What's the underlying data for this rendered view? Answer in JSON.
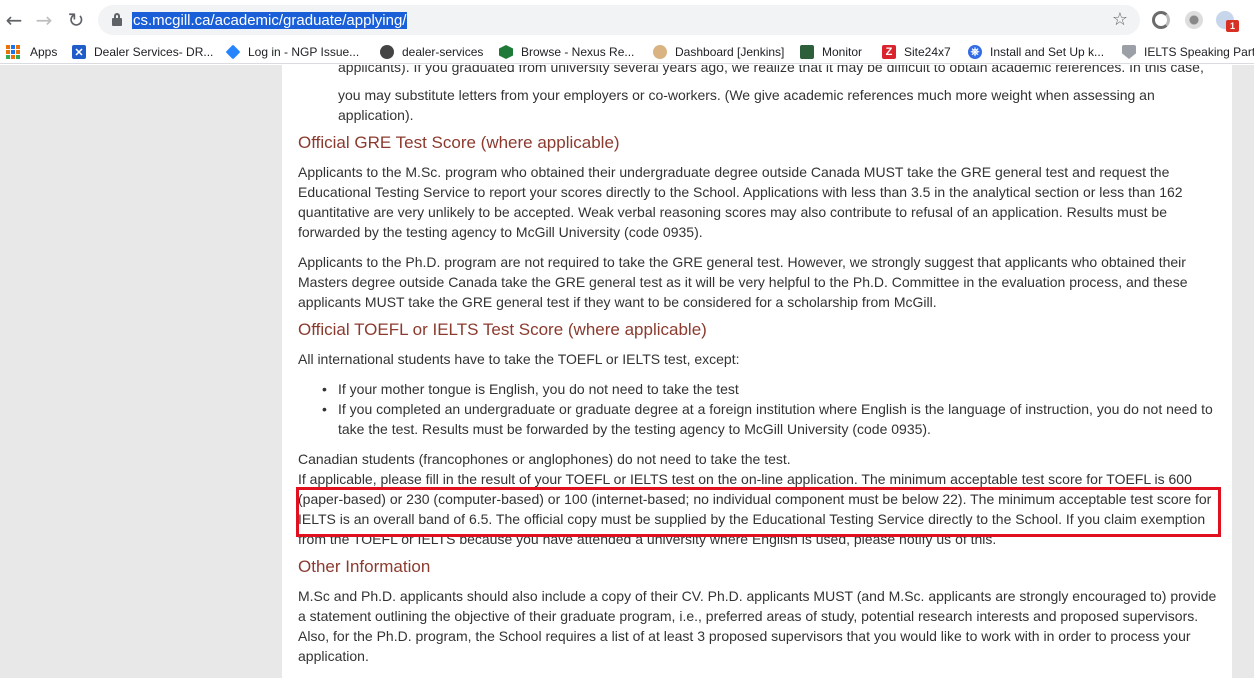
{
  "browser": {
    "url": "cs.mcgill.ca/academic/graduate/applying/",
    "nav": {
      "back": "←",
      "forward": "→",
      "reload": "↻"
    },
    "star": "☆",
    "extension_badge": "1",
    "bookmarks": [
      {
        "label": "Apps",
        "icon": "apps-grid-icon"
      },
      {
        "label": "Dealer Services- DR...",
        "icon": "confluence-icon"
      },
      {
        "label": "Log in - NGP Issue...",
        "icon": "jira-icon"
      },
      {
        "label": "dealer-services",
        "icon": "github-icon"
      },
      {
        "label": "Browse - Nexus Re...",
        "icon": "nexus-icon"
      },
      {
        "label": "Dashboard [Jenkins]",
        "icon": "jenkins-icon"
      },
      {
        "label": "Monitor",
        "icon": "monitor-icon"
      },
      {
        "label": "Site24x7",
        "icon": "site24x7-icon"
      },
      {
        "label": "Install and Set Up k...",
        "icon": "kubernetes-icon"
      },
      {
        "label": "IELTS Speaking Part...",
        "icon": "ielts-icon"
      }
    ]
  },
  "page": {
    "intro_tail": [
      "applicants). If you graduated from university several years ago, we realize that it may be difficult to obtain academic references. In this case,",
      "you may substitute letters from your employers or co-workers. (We give academic references much more weight when assessing an",
      "application)."
    ],
    "gre": {
      "heading": "Official GRE Test Score (where applicable)",
      "p1": [
        "Applicants to the M.Sc. program who obtained their undergraduate degree outside Canada MUST take the GRE general test and request the",
        "Educational Testing Service to report your scores directly to the School. Applications with less than 3.5 in the analytical section or less than 162",
        "quantitative are very unlikely to be accepted. Weak verbal reasoning scores may also contribute to refusal of an application. Results must be",
        "forwarded by the testing agency to McGill University (code 0935)."
      ],
      "p2": [
        "Applicants to the Ph.D. program are not required to take the GRE general test. However, we strongly suggest that applicants who obtained their",
        "Masters degree outside Canada take the GRE general test as it will be very helpful to the Ph.D. Committee in the evaluation process, and these",
        "applicants MUST take the GRE general test if they want to be considered for a scholarship from McGill."
      ]
    },
    "toefl": {
      "heading": "Official TOEFL or IELTS Test Score (where applicable)",
      "intro": "All international students have to take the TOEFL or IELTS test, except:",
      "bullets": [
        [
          "If your mother tongue is English, you do not need to take the test"
        ],
        [
          "If you completed an undergraduate or graduate degree at a foreign institution where English is the language of instruction, you do not need to",
          "take the test. Results must be forwarded by the testing agency to McGill University (code 0935)."
        ]
      ],
      "para": [
        "Canadian students (francophones or anglophones) do not need to take the test.",
        "If applicable, please fill in the result of your TOEFL or IELTS test on the on-line application. The minimum acceptable test score for TOEFL is 600",
        "(paper-based) or 230 (computer-based) or 100 (internet-based; no individual component must be below 22). The minimum acceptable test score for",
        "IELTS is an overall band of 6.5. The official copy must be supplied by the Educational Testing Service directly to the School. If you claim exemption",
        "from the TOEFL or IELTS because you have attended a university where English is used, please notify us of this."
      ]
    },
    "other": {
      "heading": "Other Information",
      "p": [
        "M.Sc and Ph.D. applicants should also include a copy of their CV. Ph.D. applicants MUST (and M.Sc. applicants are strongly encouraged to) provide",
        "a statement outlining the objective of their graduate program, i.e., preferred areas of study, potential research interests and proposed supervisors.",
        "Also, for the Ph.D. program, the School requires a list of at least 3 proposed supervisors that you would like to work with in order to process your",
        "application."
      ]
    }
  },
  "colors": {
    "heading": "#8b3a2e",
    "annotation": "#e0101f",
    "url_selection": "#1a5fd8"
  }
}
